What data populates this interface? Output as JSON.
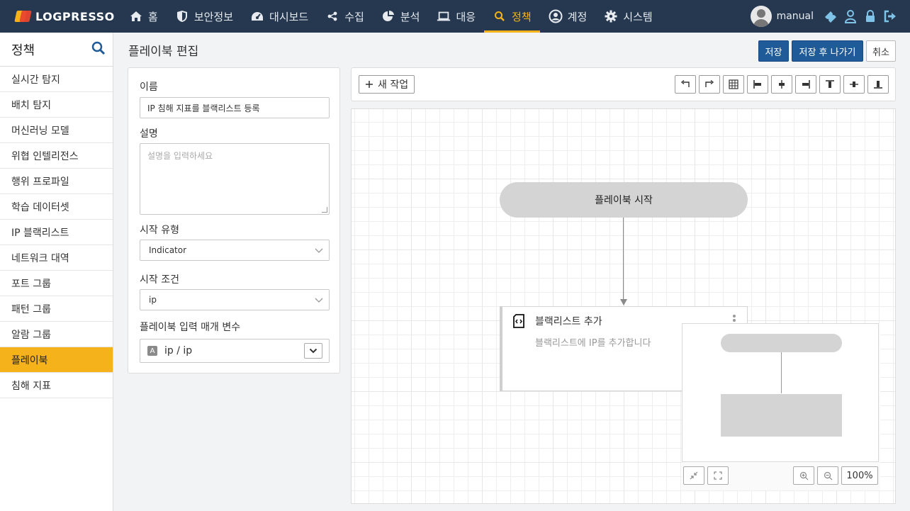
{
  "app": {
    "logo": "LOGPRESSO"
  },
  "nav": [
    {
      "label": "홈",
      "icon": "home-icon"
    },
    {
      "label": "보안정보",
      "icon": "shield-icon"
    },
    {
      "label": "대시보드",
      "icon": "dashboard-icon"
    },
    {
      "label": "수집",
      "icon": "share-icon"
    },
    {
      "label": "분석",
      "icon": "pie-chart-icon"
    },
    {
      "label": "대응",
      "icon": "laptop-icon"
    },
    {
      "label": "정책",
      "icon": "search-icon",
      "active": true
    },
    {
      "label": "계정",
      "icon": "user-circle-icon"
    },
    {
      "label": "시스템",
      "icon": "gear-icon"
    }
  ],
  "user": {
    "name": "manual"
  },
  "sidebar": {
    "title": "정책",
    "items": [
      {
        "label": "실시간 탐지"
      },
      {
        "label": "배치 탐지"
      },
      {
        "label": "머신러닝 모델"
      },
      {
        "label": "위협 인텔리전스"
      },
      {
        "label": "행위 프로파일"
      },
      {
        "label": "학습 데이터셋"
      },
      {
        "label": "IP 블랙리스트"
      },
      {
        "label": "네트워크 대역"
      },
      {
        "label": "포트 그룹"
      },
      {
        "label": "패턴 그룹"
      },
      {
        "label": "알람 그룹"
      },
      {
        "label": "플레이북",
        "active": true
      },
      {
        "label": "침해 지표"
      }
    ]
  },
  "page": {
    "title": "플레이북 편집",
    "save_label": "저장",
    "save_exit_label": "저장 후 나가기",
    "cancel_label": "취소"
  },
  "form": {
    "name_label": "이름",
    "name_value": "IP 침해 지표를 블랙리스트 등록",
    "desc_label": "설명",
    "desc_placeholder": "설명을 입력하세요",
    "start_type_label": "시작 유형",
    "start_type_value": "Indicator",
    "start_cond_label": "시작 조건",
    "start_cond_value": "ip",
    "params_label": "플레이북 입력 매개 변수",
    "param_type_badge": "A",
    "param_value": "ip / ip"
  },
  "toolbar": {
    "new_task_label": "새 작업"
  },
  "canvas": {
    "start_node_label": "플레이북 시작",
    "task_title": "블랙리스트 추가",
    "task_desc": "블랙리스트에 IP를 추가합니다",
    "zoom_level": "100%"
  },
  "colors": {
    "topbar": "#25384f",
    "accent": "#f6b21b",
    "primary_button": "#1f5b99"
  }
}
